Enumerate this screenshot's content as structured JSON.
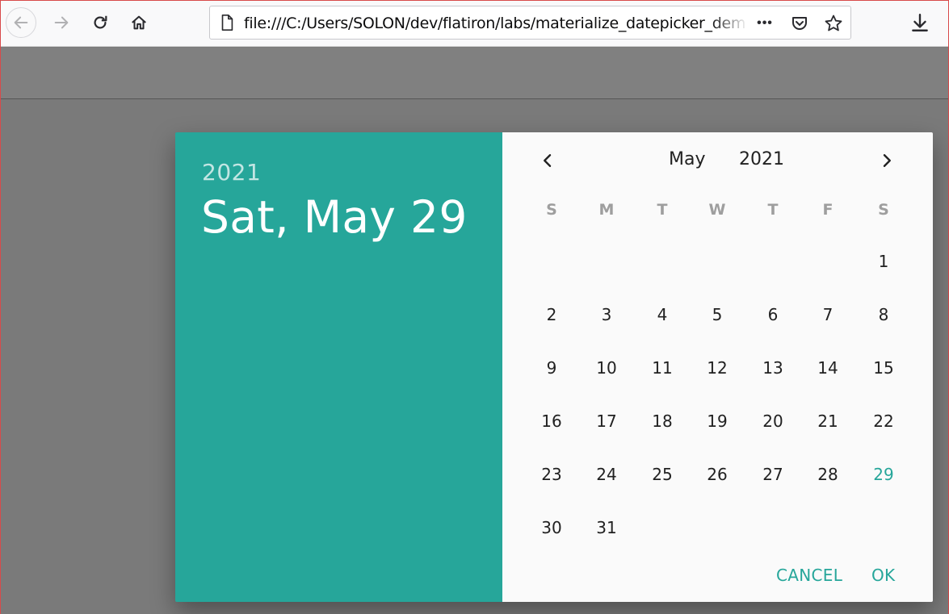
{
  "browser": {
    "url": "file:///C:/Users/SOLON/dev/flatiron/labs/materialize_datepicker_dem",
    "more_label": "•••"
  },
  "datepicker": {
    "selected_year": "2021",
    "selected_date_label": "Sat, May 29",
    "month": "May",
    "year": "2021",
    "weekdays": [
      "S",
      "M",
      "T",
      "W",
      "T",
      "F",
      "S"
    ],
    "weeks": [
      [
        "",
        "",
        "",
        "",
        "",
        "",
        "1"
      ],
      [
        "2",
        "3",
        "4",
        "5",
        "6",
        "7",
        "8"
      ],
      [
        "9",
        "10",
        "11",
        "12",
        "13",
        "14",
        "15"
      ],
      [
        "16",
        "17",
        "18",
        "19",
        "20",
        "21",
        "22"
      ],
      [
        "23",
        "24",
        "25",
        "26",
        "27",
        "28",
        "29"
      ],
      [
        "30",
        "31",
        "",
        "",
        "",
        "",
        ""
      ]
    ],
    "selected_day": "29",
    "cancel_label": "CANCEL",
    "ok_label": "OK",
    "accent_color": "#26a69a"
  }
}
